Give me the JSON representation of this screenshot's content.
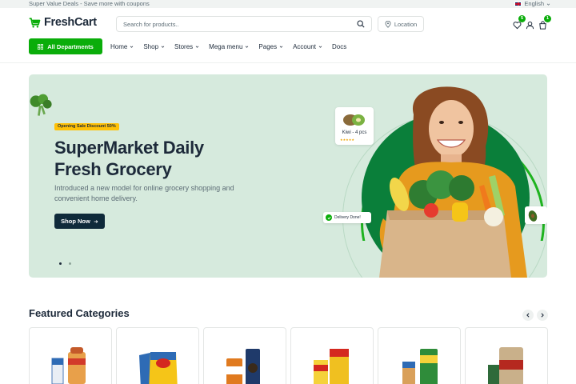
{
  "topbar": {
    "promo": "Super Value Deals - Save more with coupons",
    "language": "English"
  },
  "header": {
    "logo_text": "FreshCart",
    "search_placeholder": "Search for products..",
    "location_label": "Location",
    "wishlist_count": "5",
    "cart_count": "1"
  },
  "nav": {
    "all_departments": "All Departments",
    "items": [
      {
        "label": "Home"
      },
      {
        "label": "Shop"
      },
      {
        "label": "Stores"
      },
      {
        "label": "Mega menu"
      },
      {
        "label": "Pages"
      },
      {
        "label": "Account"
      },
      {
        "label": "Docs"
      }
    ]
  },
  "hero": {
    "badge": "Opening Sale Discount 50%",
    "title_line1": "SuperMarket Daily",
    "title_line2": "Fresh Grocery",
    "subtitle": "Introduced a new model for online grocery shopping and convenient home delivery.",
    "cta": "Shop Now",
    "kiwi_label": "Kiwi - 4 pcs",
    "kiwi_rating": "★★★★★",
    "delivery_label": "Delivery Done!"
  },
  "featured": {
    "title": "Featured Categories",
    "categories": [
      {
        "icon": "bread-milk-icon"
      },
      {
        "icon": "chips-icon"
      },
      {
        "icon": "cookies-icon"
      },
      {
        "icon": "cereal-icon"
      },
      {
        "icon": "flour-icon"
      },
      {
        "icon": "rice-bag-icon"
      }
    ]
  },
  "colors": {
    "brand_green": "#0aad0a",
    "dark_navy": "#0f2a3a",
    "hero_bg": "#d6eadd",
    "badge_yellow": "#ffc107"
  }
}
